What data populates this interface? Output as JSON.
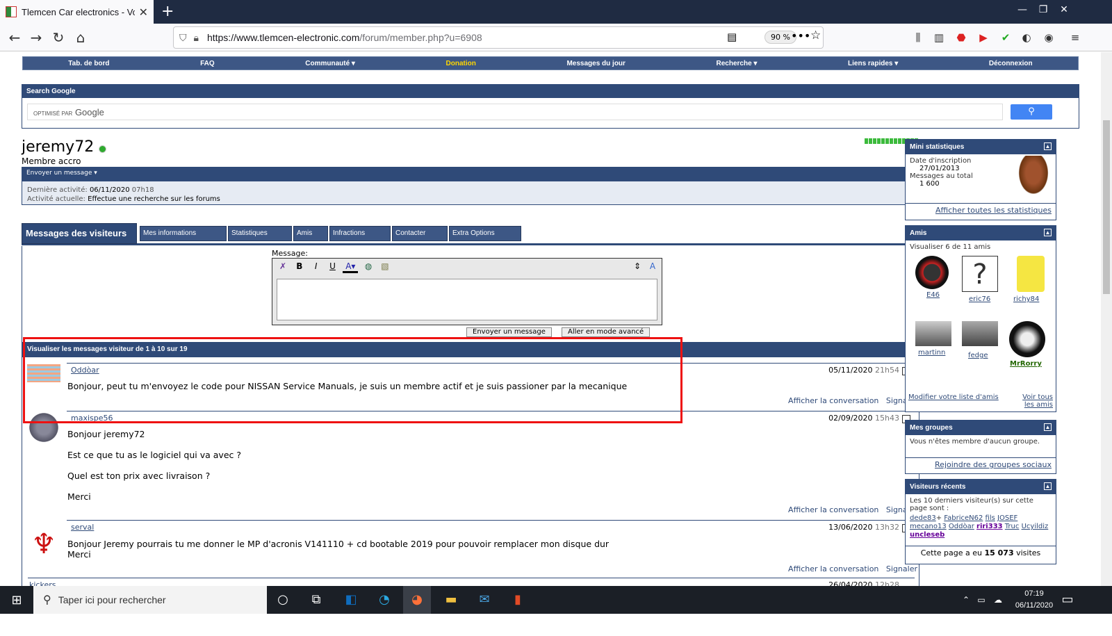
{
  "browser": {
    "tab_title": "Tlemcen Car electronics - Voir le profil",
    "url_domain": "https://www.tlemcen-electronic.com",
    "url_path": "/forum/member.php?u=6908",
    "zoom": "90 %"
  },
  "topnav": [
    "Tab. de bord",
    "FAQ",
    "Communauté ▾",
    "Donation",
    "Messages du jour",
    "Recherche ▾",
    "Liens rapides ▾",
    "Déconnexion"
  ],
  "google": {
    "title": "Search Google",
    "powered": "OPTIMISÉ PAR",
    "brand": "Google"
  },
  "profile": {
    "username": "jeremy72",
    "title": "Membre accro",
    "send_message": "Envoyer un message ▾",
    "last_activity_label": "Dernière activité:",
    "last_activity_date": "06/11/2020",
    "last_activity_time": "07h18",
    "current_activity_label": "Activité actuelle:",
    "current_activity": "Effectue une recherche sur les forums"
  },
  "tabs": [
    "Messages des visiteurs",
    "Mes informations",
    "Statistiques",
    "Amis",
    "Infractions",
    "Contacter",
    "Extra Options"
  ],
  "editor": {
    "label": "Message:",
    "send": "Envoyer un message",
    "advanced": "Aller en mode avancé"
  },
  "visitor_header": "Visualiser les messages visiteur de 1 à 10 sur 19",
  "messages": [
    {
      "user": "Oddòar",
      "date": "05/11/2020",
      "time": "21h54",
      "text": "Bonjour, peut tu m'envoyez le code pour NISSAN Service Manuals, je suis un membre actif et je suis passioner par la mecanique",
      "conv": "Afficher la conversation",
      "report": "Signaler"
    },
    {
      "user": "maxispe56",
      "date": "02/09/2020",
      "time": "15h43",
      "text": "Bonjour jeremy72\n\nEst ce que tu as le logiciel qui va avec ?\n\nQuel est ton prix avec livraison ?\n\nMerci",
      "conv": "Afficher la conversation",
      "report": "Signaler"
    },
    {
      "user": "serval",
      "date": "13/06/2020",
      "time": "13h32",
      "text": "Bonjour Jeremy pourrais tu me donner le MP d'acronis V141110 + cd bootable 2019 pour pouvoir remplacer mon disque dur\nMerci",
      "conv": "Afficher la conversation",
      "report": "Signaler"
    },
    {
      "user": "kickers",
      "date": "26/04/2020",
      "time": "12h28"
    }
  ],
  "sidebar": {
    "stats": {
      "title": "Mini statistiques",
      "join_label": "Date d'inscription",
      "join": "27/01/2013",
      "posts_label": "Messages au total",
      "posts": "1 600",
      "link": "Afficher toutes les statistiques"
    },
    "friends": {
      "title": "Amis",
      "count": "Visualiser 6 de 11 amis",
      "names": [
        "E46",
        "eric76",
        "richy84",
        "martinn",
        "fedge",
        "MrRorry"
      ],
      "edit": "Modifier votre liste d'amis",
      "all": "Voir tous les amis"
    },
    "groups": {
      "title": "Mes groupes",
      "text": "Vous n'êtes membre d'aucun groupe.",
      "link": "Rejoindre des groupes sociaux"
    },
    "visitors": {
      "title": "Visiteurs récents",
      "text": "Les 10 derniers visiteur(s) sur cette page sont :",
      "names": [
        "dede83",
        "FabriceN62",
        "fils",
        "JOSEF",
        "mecano13",
        "Oddòar",
        "riri333",
        "Truc",
        "Ucyildiz",
        "uncleseb"
      ],
      "views_prefix": "Cette page a eu",
      "views": "15 073",
      "views_suffix": "visites"
    }
  },
  "taskbar": {
    "search": "Taper ici pour rechercher",
    "time": "07:19",
    "date": "06/11/2020"
  }
}
